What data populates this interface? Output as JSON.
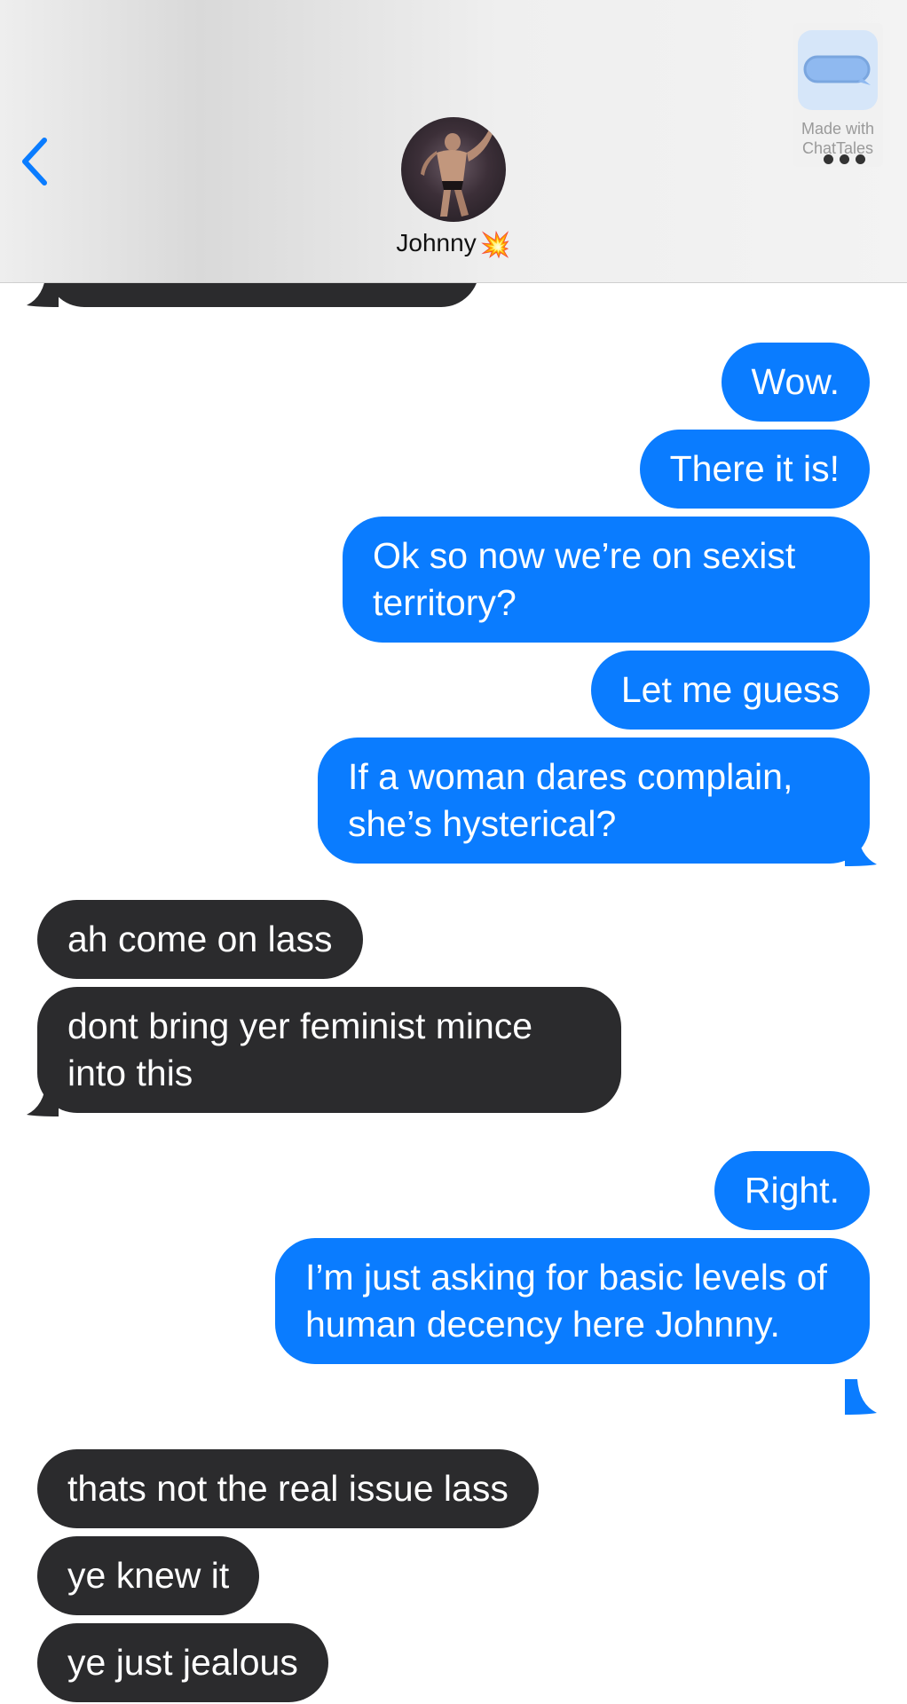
{
  "header": {
    "contact_name": "Johnny",
    "contact_emoji": "💥",
    "back_icon": "chevron-left-icon",
    "more_icon": "ellipsis-icon",
    "watermark_line1": "Made with",
    "watermark_line2": "ChatTales"
  },
  "colors": {
    "outgoing_bubble": "#0a7cff",
    "incoming_bubble": "#2b2b2d",
    "accent": "#0a7cff"
  },
  "messages": [
    {
      "from": "them",
      "text": ""
    },
    {
      "from": "me",
      "text": "Wow."
    },
    {
      "from": "me",
      "text": "There it is!"
    },
    {
      "from": "me",
      "text": "Ok so now we’re on sexist territory?"
    },
    {
      "from": "me",
      "text": "Let me guess"
    },
    {
      "from": "me",
      "text": "If a woman dares complain, she’s hysterical?"
    },
    {
      "from": "them",
      "text": "ah come on lass"
    },
    {
      "from": "them",
      "text": "dont bring yer feminist mince into this"
    },
    {
      "from": "me",
      "text": "Right."
    },
    {
      "from": "me",
      "text": "I’m just asking for basic levels of human decency here Johnny."
    },
    {
      "from": "them",
      "text": "thats not the real issue lass"
    },
    {
      "from": "them",
      "text": "ye knew it"
    },
    {
      "from": "them",
      "text": "ye just jealous"
    }
  ]
}
